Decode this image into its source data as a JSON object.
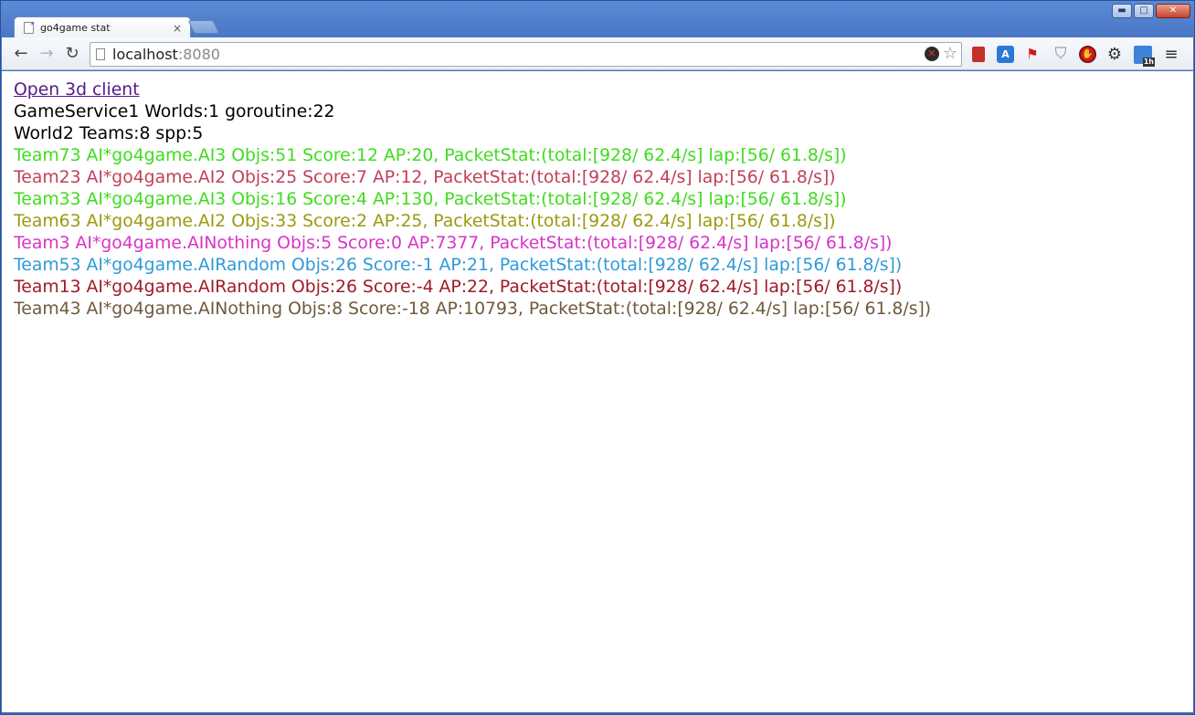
{
  "browser": {
    "tab": {
      "title": "go4game stat",
      "close_glyph": "×"
    },
    "window_controls": {
      "minimize": "▬",
      "maximize": "□",
      "close": "✕"
    },
    "toolbar": {
      "back_glyph": "←",
      "forward_glyph": "→",
      "reload_glyph": "↻",
      "url_host": "localhost",
      "url_port": ":8080",
      "stop_glyph": "✕",
      "star_glyph": "☆",
      "menu_glyph": "≡",
      "gear_glyph": "⚙",
      "shield_glyph": "⛉",
      "flag_glyph": "⚑",
      "translate_glyph": "A",
      "adblock_glyph": "✋",
      "calendar_badge": "1h"
    }
  },
  "page": {
    "link_text": "Open 3d client",
    "service_line": "GameService1 Worlds:1 goroutine:22",
    "world_line": "World2 Teams:8 spp:5",
    "teams": [
      {
        "text": "Team73 AI*go4game.AI3 Objs:51 Score:12 AP:20, PacketStat:(total:[928/ 62.4/s] lap:[56/ 61.8/s])",
        "color": "#3fdc1e"
      },
      {
        "text": "Team23 AI*go4game.AI2 Objs:25 Score:7 AP:12, PacketStat:(total:[928/ 62.4/s] lap:[56/ 61.8/s])",
        "color": "#c0405a"
      },
      {
        "text": "Team33 AI*go4game.AI3 Objs:16 Score:4 AP:130, PacketStat:(total:[928/ 62.4/s] lap:[56/ 61.8/s])",
        "color": "#3fdc1e"
      },
      {
        "text": "Team63 AI*go4game.AI2 Objs:33 Score:2 AP:25, PacketStat:(total:[928/ 62.4/s] lap:[56/ 61.8/s])",
        "color": "#9a9a12"
      },
      {
        "text": "Team3 AI*go4game.AINothing Objs:5 Score:0 AP:7377, PacketStat:(total:[928/ 62.4/s] lap:[56/ 61.8/s])",
        "color": "#d833c8"
      },
      {
        "text": "Team53 AI*go4game.AIRandom Objs:26 Score:-1 AP:21, PacketStat:(total:[928/ 62.4/s] lap:[56/ 61.8/s])",
        "color": "#2f9ad8"
      },
      {
        "text": "Team13 AI*go4game.AIRandom Objs:26 Score:-4 AP:22, PacketStat:(total:[928/ 62.4/s] lap:[56/ 61.8/s])",
        "color": "#a01a26"
      },
      {
        "text": "Team43 AI*go4game.AINothing Objs:8 Score:-18 AP:10793, PacketStat:(total:[928/ 62.4/s] lap:[56/ 61.8/s])",
        "color": "#6e5a3c"
      }
    ]
  }
}
